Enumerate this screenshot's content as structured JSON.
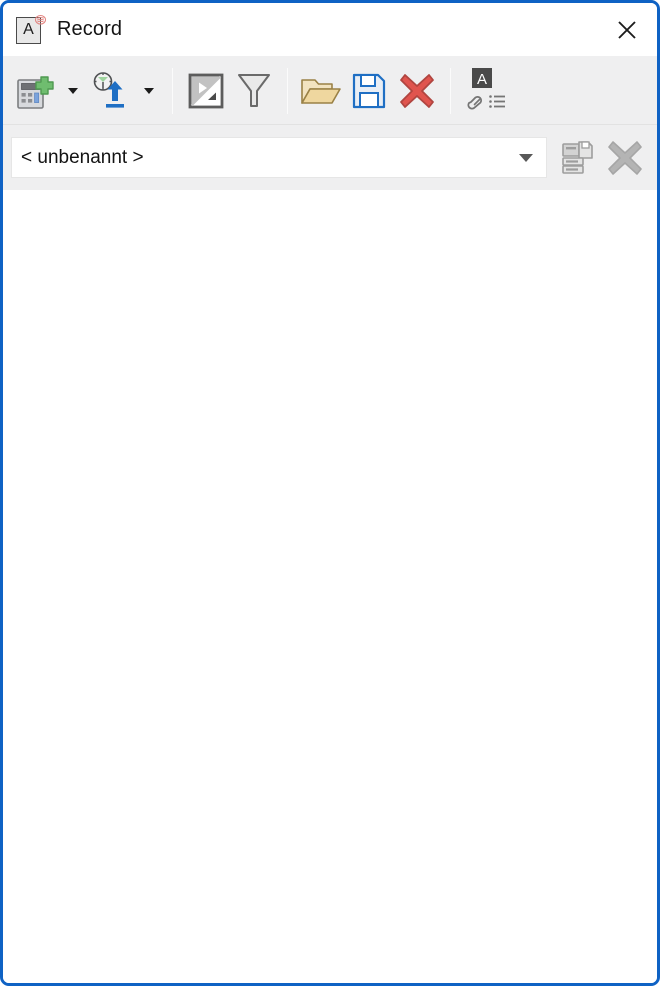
{
  "window": {
    "title": "Record",
    "border_color": "#0f62c4",
    "app_icon": "document-a-stamp-icon",
    "close_label": "✕"
  },
  "toolbar": {
    "items": [
      {
        "name": "new-record-button",
        "icon": "calculator-plus-icon",
        "tooltip": "New record"
      },
      {
        "name": "new-record-dropdown",
        "icon": "chevron-down-icon",
        "tooltip": "New record options"
      },
      {
        "name": "load-time-button",
        "icon": "clock-upload-icon",
        "tooltip": "Load from timer"
      },
      {
        "name": "load-time-dropdown",
        "icon": "chevron-down-icon",
        "tooltip": "Load options"
      },
      {
        "name": "separator-1",
        "icon": "separator",
        "tooltip": ""
      },
      {
        "name": "invert-selection-button",
        "icon": "contrast-square-icon",
        "tooltip": "Invert selection"
      },
      {
        "name": "filter-button",
        "icon": "funnel-icon",
        "tooltip": "Filter"
      },
      {
        "name": "separator-2",
        "icon": "separator",
        "tooltip": ""
      },
      {
        "name": "open-button",
        "icon": "folder-open-icon",
        "tooltip": "Open"
      },
      {
        "name": "save-button",
        "icon": "floppy-save-icon",
        "tooltip": "Save"
      },
      {
        "name": "delete-button",
        "icon": "red-x-delete-icon",
        "tooltip": "Delete"
      },
      {
        "name": "separator-3",
        "icon": "separator",
        "tooltip": ""
      },
      {
        "name": "attributes-button",
        "icon": "a-square-link-list-icon",
        "tooltip": "Attributes"
      }
    ]
  },
  "combo_row": {
    "combo": {
      "name": "record-name-combo",
      "value": "< unbenannt >",
      "placeholder": "< unbenannt >",
      "caret": "chevron-down-icon"
    },
    "buttons": [
      {
        "name": "save-as-button",
        "icon": "save-as-printer-icon",
        "enabled": false
      },
      {
        "name": "clear-button",
        "icon": "gray-x-icon",
        "enabled": false
      }
    ]
  },
  "content": {
    "empty": ""
  },
  "colors": {
    "window_border": "#0f62c4",
    "toolbar_bg": "#efeff0",
    "content_bg": "#ffffff",
    "accent_blue": "#1f6fc4",
    "danger_red": "#d9534f",
    "plus_green": "#63b363",
    "folder_yellow": "#e8c07a",
    "disabled_gray": "#b4b4b4"
  }
}
